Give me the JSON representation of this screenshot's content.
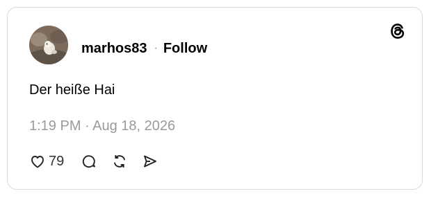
{
  "post": {
    "username": "marhos83",
    "separator": "·",
    "follow_label": "Follow",
    "text": "Der heiße Hai",
    "timestamp": "1:19 PM · Aug 18, 2026",
    "like_count": "79"
  },
  "icons": {
    "logo": "threads-logo-icon",
    "like": "heart-icon",
    "reply": "comment-icon",
    "repost": "repost-icon",
    "share": "send-icon"
  },
  "colors": {
    "text": "#000000",
    "muted": "#9a9a9a",
    "border": "#d9d9d9"
  }
}
